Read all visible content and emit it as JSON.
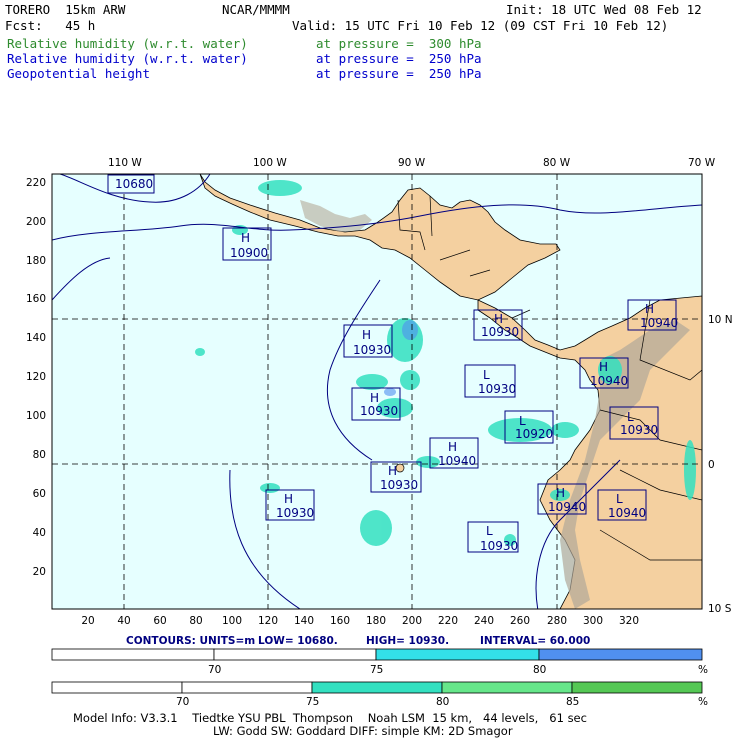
{
  "header": {
    "model": "TORERO  15km ARW",
    "org": "NCAR/MMMM",
    "init": "Init: 18 UTC Wed 08 Feb 12",
    "fcst": "Fcst:   45 h",
    "valid": "Valid: 15 UTC Fri 10 Feb 12 (09 CST Fri 10 Feb 12)",
    "fields": [
      {
        "name": "Relative humidity (w.r.t. water)",
        "level": "at pressure =  300 hPa",
        "color": "#2e8b2e"
      },
      {
        "name": "Relative humidity (w.r.t. water)",
        "level": "at pressure =  250 hPa",
        "color": "#0000cc"
      },
      {
        "name": "Geopotential height",
        "level": "at pressure =  250 hPa",
        "color": "#0000cc"
      }
    ]
  },
  "map": {
    "top_lon_labels": [
      "110 W",
      "100 W",
      "90 W",
      "80 W",
      "70 W"
    ],
    "right_lat_labels": [
      "10 N",
      "0",
      "10 S"
    ],
    "y_ticks": [
      "220",
      "200",
      "180",
      "160",
      "140",
      "120",
      "100",
      "80",
      "60",
      "40",
      "20"
    ],
    "x_ticks": [
      "20",
      "40",
      "60",
      "80",
      "100",
      "120",
      "140",
      "160",
      "180",
      "200",
      "220",
      "240",
      "260",
      "280",
      "300",
      "320"
    ],
    "ocean_color": "#e6ffff",
    "land_color": "#f4d0a0",
    "contour_color": "#000080",
    "centers": [
      {
        "type": "",
        "value": "10680"
      },
      {
        "type": "H",
        "value": "10900"
      },
      {
        "type": "H",
        "value": "10930"
      },
      {
        "type": "H",
        "value": "10930"
      },
      {
        "type": "H",
        "value": "10930"
      },
      {
        "type": "L",
        "value": "10930"
      },
      {
        "type": "L",
        "value": "10920"
      },
      {
        "type": "H",
        "value": "10940"
      },
      {
        "type": "H",
        "value": "10940"
      },
      {
        "type": "L",
        "value": "10930"
      },
      {
        "type": "H",
        "value": "10940"
      },
      {
        "type": "H",
        "value": "10930"
      },
      {
        "type": "H",
        "value": "10930"
      },
      {
        "type": "H",
        "value": "10940"
      },
      {
        "type": "L",
        "value": "10940"
      },
      {
        "type": "L",
        "value": "10930"
      }
    ]
  },
  "contours_caption": {
    "units": "CONTOURS:  UNITS=m",
    "low": "LOW=  10680.",
    "high": "HIGH=  10930.",
    "interval": "INTERVAL=   60.000"
  },
  "colorbar1": {
    "labels": [
      "70",
      "75",
      "80",
      "%"
    ],
    "colors": [
      "#ffffff",
      "#ffffff",
      "#33e0e8",
      "#5090f0"
    ]
  },
  "colorbar2": {
    "labels": [
      "70",
      "75",
      "80",
      "85",
      "%"
    ],
    "colors": [
      "#ffffff",
      "#ffffff",
      "#33e0c0",
      "#66e68a",
      "#55c855"
    ]
  },
  "footer": {
    "line1": "Model Info: V3.3.1    Tiedtke YSU PBL  Thompson    Noah LSM  15 km,   44 levels,   61 sec",
    "line2": "LW: Godd SW: Goddard DIFF: simple KM: 2D Smagor"
  }
}
